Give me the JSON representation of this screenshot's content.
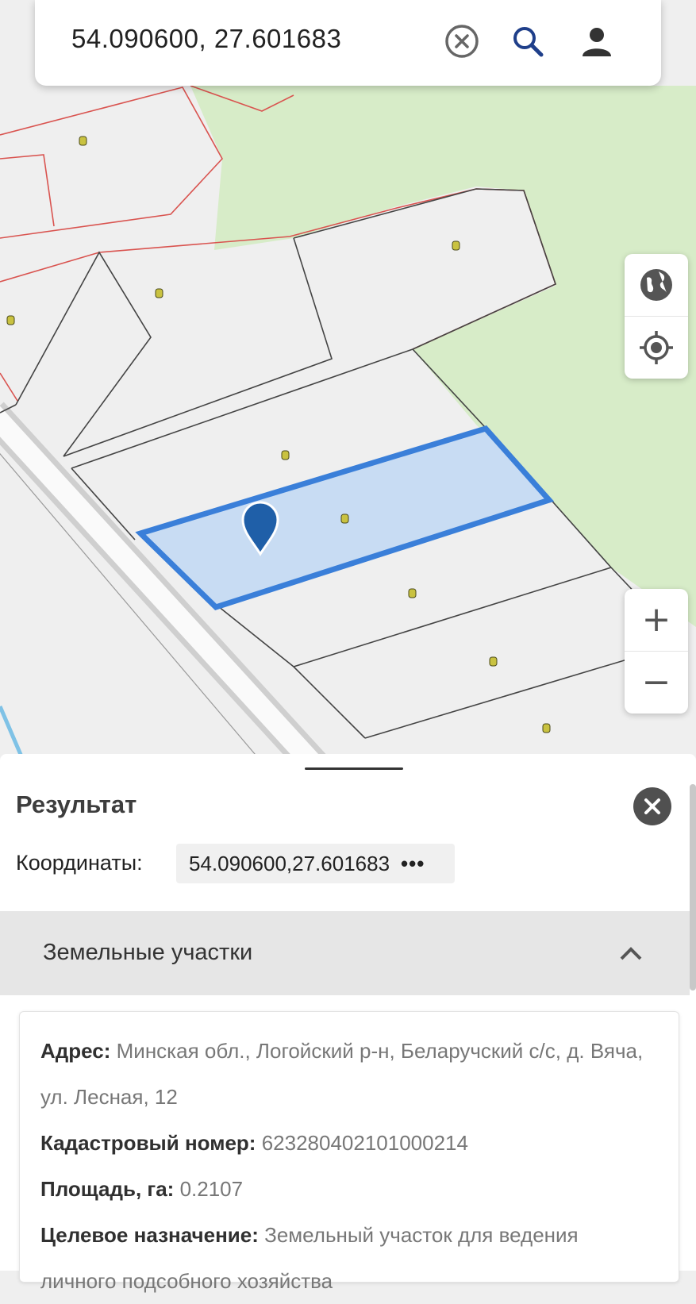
{
  "search": {
    "query": "54.090600, 27.601683"
  },
  "icons": {
    "clear": "close-circle-icon",
    "search": "search-icon",
    "user": "account-icon",
    "globe": "globe-icon",
    "locate": "my-location-icon",
    "close": "close-icon",
    "chevron": "chevron-up-icon",
    "marker": "map-pin-icon"
  },
  "map_controls": {
    "zoom_in": "+",
    "zoom_out": "−"
  },
  "colors": {
    "selected_parcel": "#3a7fd9",
    "selected_fill": "#c5daf2",
    "parcel_border": "#444444",
    "restricted_border": "#d9534f",
    "forest": "#d7ecc8",
    "marker": "#1f5fa8"
  },
  "result": {
    "title": "Результат",
    "coordinates_label": "Координаты:",
    "coordinates_value": "54.090600,27.601683",
    "coordinates_more": "•••"
  },
  "section": {
    "title": "Земельные участки",
    "parcel": {
      "address_label": "Адрес:",
      "address_value": "Минская обл., Логойский р-н, Беларучский с/с, д. Вяча, ул. Лесная, 12",
      "cadastral_label": "Кадастровый номер:",
      "cadastral_value": "623280402101000214",
      "area_label": "Площадь, га:",
      "area_value": "0.2107",
      "purpose_label": "Целевое назначение:",
      "purpose_value": "Земельный участок для ведения личного подсобного хозяйства"
    }
  }
}
